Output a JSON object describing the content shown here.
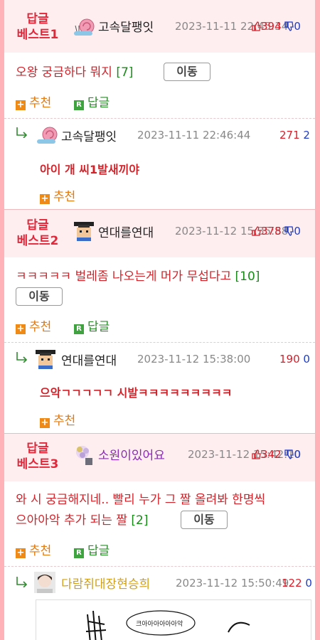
{
  "colors": {
    "accent_red": "#e0283a",
    "up_red": "#d61f2a",
    "down_blue": "#1d3cc9",
    "frame_pink": "#ffb3b8",
    "head_pink": "#ffeef0"
  },
  "labels": {
    "move": "이동",
    "recommend": "추천",
    "reply": "답글"
  },
  "posts": [
    {
      "badge_line1": "답글",
      "badge_line2": "베스트1",
      "avatar": "snail-avatar-icon",
      "nickname": "고속달팽잇",
      "date": "2023-11-11 22:45:34",
      "up": "394",
      "down": "0",
      "text": "오왕 궁금하다 뭐지",
      "comment_count": "[7]",
      "reply": {
        "avatar": "snail-avatar-icon",
        "nickname": "고속달팽잇",
        "date": "2023-11-11 22:46:44",
        "up": "271",
        "down": "2",
        "text": "아이 개 씨1발새끼야"
      }
    },
    {
      "badge_line1": "답글",
      "badge_line2": "베스트2",
      "avatar": "pixel-graduate-avatar-icon",
      "nickname": "연대를연대",
      "date": "2023-11-12 15:35:58",
      "up": "378",
      "down": "0",
      "text": "ㅋㅋㅋㅋㅋ 벌레좀 나오는게 머가 무섭다고",
      "comment_count": "[10]",
      "reply": {
        "avatar": "pixel-graduate-avatar-icon",
        "nickname": "연대를연대",
        "date": "2023-11-12 15:38:00",
        "up": "190",
        "down": "0",
        "text": "으악ㄱㄱㄱㄱㄱ 시발ㅋㅋㅋㅋㅋㅋㅋㅋㅋ"
      }
    },
    {
      "badge_line1": "답글",
      "badge_line2": "베스트3",
      "avatar": "flower-avatar-icon",
      "nickname": "소원이있어요",
      "date": "2023-11-12 15:42:10",
      "up": "342",
      "down": "0",
      "text_line1": "와 시 궁금해지네.. 빨리 누가 그 짤 올려봐 한명씩",
      "text_line2": "으아아악 추가 되는 짤",
      "comment_count": "[2]",
      "reply": {
        "avatar": "photo-avatar-icon",
        "nickname": "다람쥐대장현승희",
        "date": "2023-11-12 15:50:49",
        "up": "122",
        "down": "0",
        "bubble_text": "크아아아아아아악"
      }
    }
  ]
}
